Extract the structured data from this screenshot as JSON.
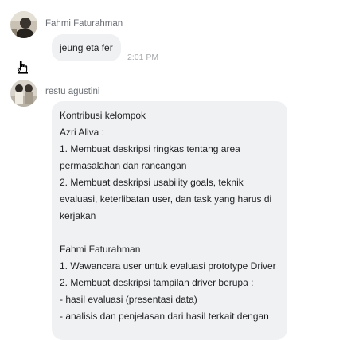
{
  "conversation": {
    "message1": {
      "sender": "Fahmi Faturahman",
      "text": "jeung eta fer",
      "time": "2:01 PM"
    },
    "message2": {
      "sender": "restu agustini",
      "lines": [
        "Kontribusi kelompok",
        "Azri Aliva :",
        "1. Membuat deskripsi ringkas tentang area",
        "permasalahan dan rancangan",
        "2. Membuat deskripsi usability goals, teknik",
        "evaluasi, keterlibatan user, dan task yang harus di",
        "kerjakan",
        "",
        "Fahmi Faturahman",
        "1. Wawancara user untuk evaluasi prototype Driver",
        "2. Membuat deskripsi tampilan driver berupa :",
        "- hasil evaluasi (presentasi data)",
        "- analisis dan penjelasan dari hasil terkait dengan"
      ]
    }
  },
  "icons": {
    "cursor": "hand-pointer-icon",
    "avatar1": "user-avatar-photo",
    "avatar2": "user-avatar-photo"
  },
  "colors": {
    "bubble": "#f0f1f3",
    "sender_text": "#6b6f74",
    "time_text": "#a6a9ad"
  }
}
